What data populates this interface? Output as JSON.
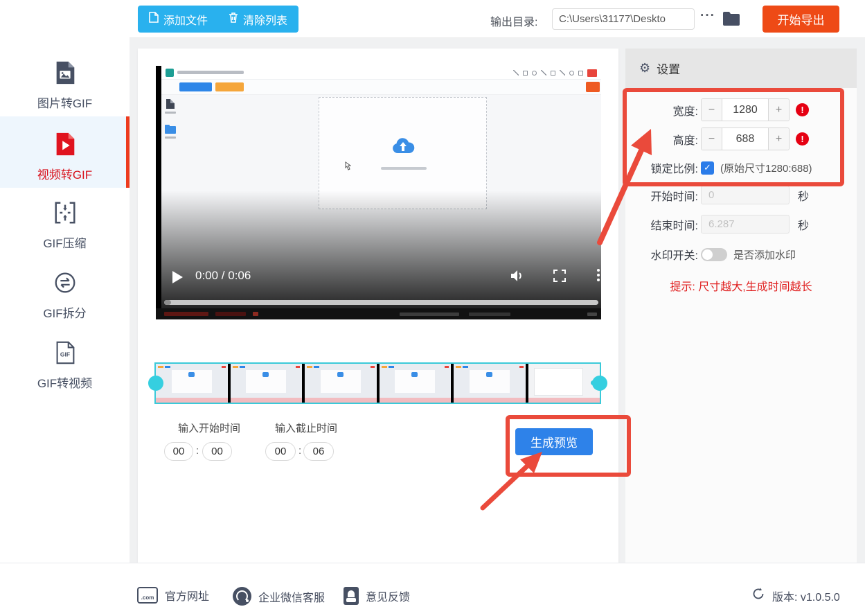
{
  "colors": {
    "accent_cyan": "#29b1ee",
    "export_red": "#ee4a16",
    "active_red": "#d8111c",
    "primary_blue": "#2e82e9",
    "annotation_red": "#ea4a3b",
    "thumb_cyan": "#3bcad9",
    "warn_red": "#e60012",
    "tip_red": "#e01f1f"
  },
  "topbar": {
    "add_file": "添加文件",
    "clear_list": "清除列表",
    "output_dir_label": "输出目录:",
    "output_dir_value": "C:\\Users\\31177\\Deskto",
    "more_label": "···",
    "export_label": "开始导出"
  },
  "sidebar": {
    "gif_badge": "GIF",
    "items": [
      {
        "label": "图片转GIF"
      },
      {
        "label": "视频转GIF"
      },
      {
        "label": "GIF压缩"
      },
      {
        "label": "GIF拆分"
      },
      {
        "label": "GIF转视频"
      }
    ]
  },
  "player": {
    "time": "0:00 / 0:06"
  },
  "trim": {
    "start_label": "输入开始时间",
    "end_label": "输入截止时间",
    "colon": ":",
    "start_min": "00",
    "start_sec": "00",
    "end_min": "00",
    "end_sec": "06",
    "preview_label": "生成预览"
  },
  "settings": {
    "title": "设置",
    "gear_icon": "⚙",
    "width_label": "宽度:",
    "width_value": "1280",
    "height_label": "高度:",
    "height_value": "688",
    "minus": "−",
    "plus": "+",
    "warn": "!",
    "lock_label": "锁定比例:",
    "check": "✓",
    "lock_note": "(原始尺寸1280:688)",
    "start_label": "开始时间:",
    "start_value": "0",
    "end_label": "结束时间:",
    "end_value": "6.287",
    "unit_seconds": "秒",
    "watermark_label": "水印开关:",
    "watermark_note": "是否添加水印",
    "tip": "提示: 尺寸越大,生成时间越长"
  },
  "footer": {
    "com_badge": ".com",
    "website": "官方网址",
    "wechat": "企业微信客服",
    "feedback": "意见反馈",
    "version": "版本: v1.0.5.0"
  }
}
